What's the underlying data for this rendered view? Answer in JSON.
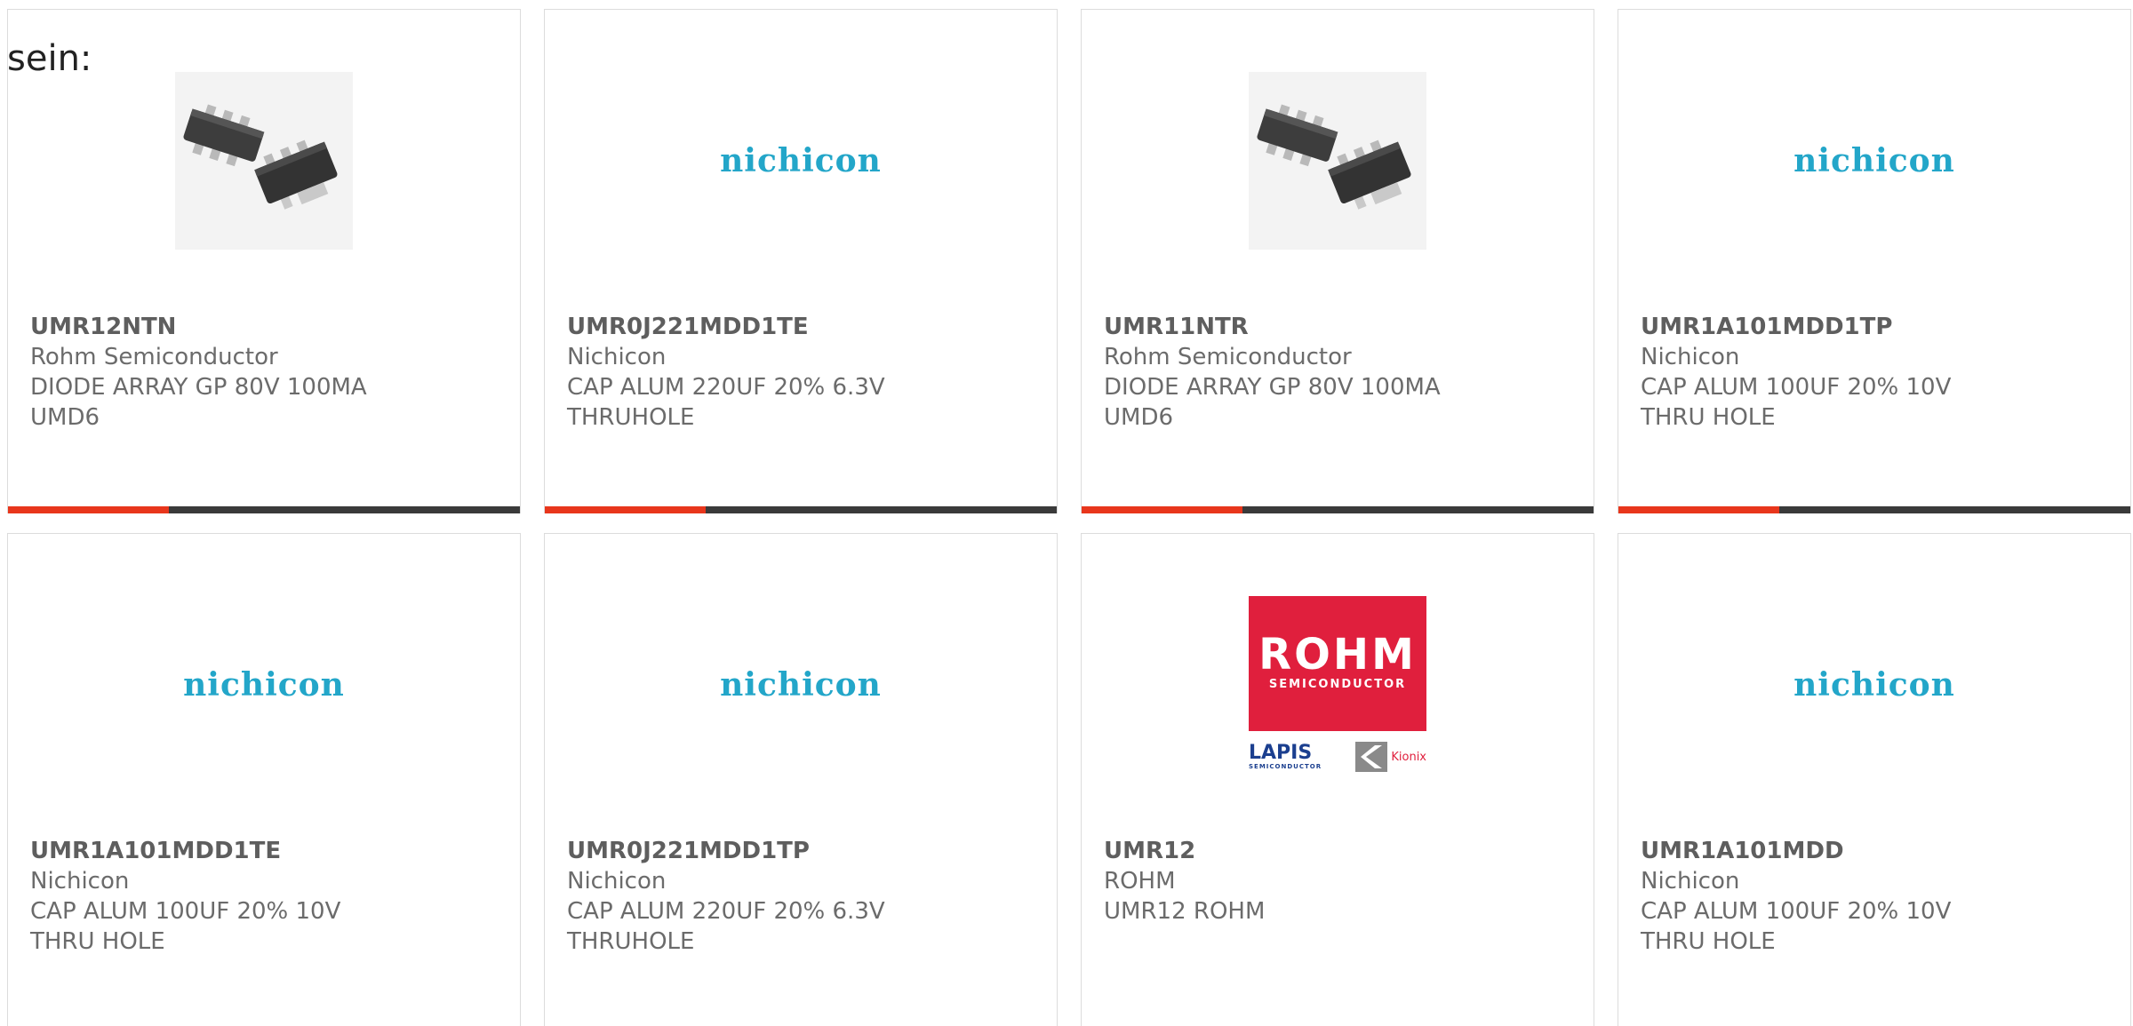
{
  "intro_text": "sein:",
  "colors": {
    "accent": "#e8361c",
    "bar_dark": "#3a3a3a",
    "nichicon_blue": "#23a6c9",
    "rohm_red": "#e01f3d"
  },
  "cards": [
    {
      "image": "chip-photo",
      "part_number": "UMR12NTN",
      "manufacturer": "Rohm Semiconductor",
      "description": "DIODE ARRAY GP 80V 100MA UMD6",
      "progress_bar": true
    },
    {
      "image": "nichicon-logo",
      "logo_text": "nichicon",
      "part_number": "UMR0J221MDD1TE",
      "manufacturer": "Nichicon",
      "description": "CAP ALUM 220UF 20% 6.3V THRUHOLE",
      "progress_bar": true
    },
    {
      "image": "chip-photo",
      "part_number": "UMR11NTR",
      "manufacturer": "Rohm Semiconductor",
      "description": "DIODE ARRAY GP 80V 100MA UMD6",
      "progress_bar": true
    },
    {
      "image": "nichicon-logo",
      "logo_text": "nichicon",
      "part_number": "UMR1A101MDD1TP",
      "manufacturer": "Nichicon",
      "description": "CAP ALUM 100UF 20% 10V THRU HOLE",
      "progress_bar": true
    },
    {
      "image": "nichicon-logo",
      "logo_text": "nichicon",
      "part_number": "UMR1A101MDD1TE",
      "manufacturer": "Nichicon",
      "description": "CAP ALUM 100UF 20% 10V THRU HOLE",
      "progress_bar": false
    },
    {
      "image": "nichicon-logo",
      "logo_text": "nichicon",
      "part_number": "UMR0J221MDD1TP",
      "manufacturer": "Nichicon",
      "description": "CAP ALUM 220UF 20% 6.3V THRUHOLE",
      "progress_bar": false
    },
    {
      "image": "rohm-logo",
      "logo_text": "ROHM",
      "logo_subtext": "SEMICONDUCTOR",
      "lapis_text": "LAPIS",
      "lapis_subtext": "SEMICONDUCTOR",
      "kionix_text": "Kionix",
      "part_number": "UMR12",
      "manufacturer": "ROHM",
      "description": "UMR12 ROHM",
      "progress_bar": false
    },
    {
      "image": "nichicon-logo",
      "logo_text": "nichicon",
      "part_number": "UMR1A101MDD",
      "manufacturer": "Nichicon",
      "description": "CAP ALUM 100UF 20% 10V THRU HOLE",
      "progress_bar": false
    }
  ]
}
